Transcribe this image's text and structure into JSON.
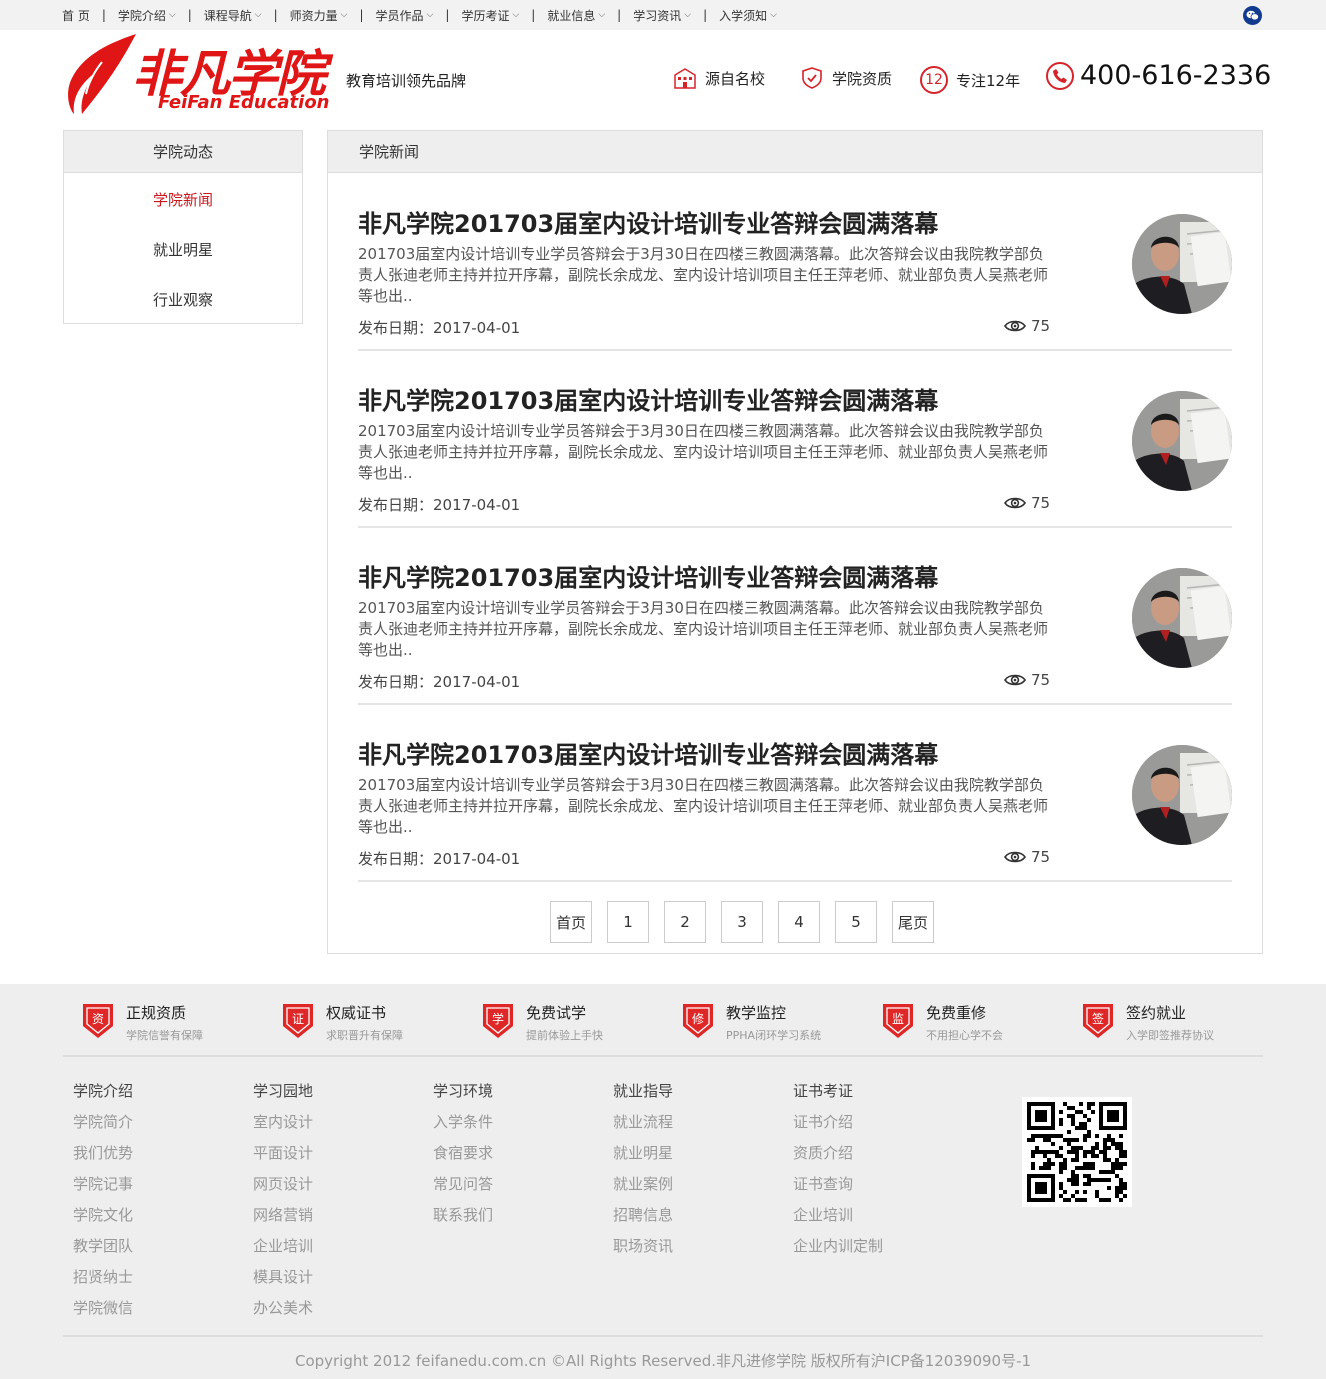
{
  "topnav": {
    "items": [
      {
        "label": "首 页",
        "dropdown": false
      },
      {
        "label": "学院介绍",
        "dropdown": true
      },
      {
        "label": "课程导航",
        "dropdown": true
      },
      {
        "label": "师资力量",
        "dropdown": true
      },
      {
        "label": "学员作品",
        "dropdown": true
      },
      {
        "label": "学历考证",
        "dropdown": true
      },
      {
        "label": "就业信息",
        "dropdown": true
      },
      {
        "label": "学习资讯",
        "dropdown": true
      },
      {
        "label": "入学须知",
        "dropdown": true
      }
    ],
    "separator": "|",
    "wechat_icon": "wechat-icon"
  },
  "header": {
    "logo_cn": "非凡学院",
    "logo_en": "FeiFan Education",
    "slogan": "教育培训领先品牌",
    "features": [
      {
        "label": "源自名校",
        "icon": "school-building-icon"
      },
      {
        "label": "学院资质",
        "icon": "shield-check-icon"
      },
      {
        "label": "专注12年",
        "icon": "number-badge-icon",
        "badge": "12"
      }
    ],
    "phone": "400-616-2336",
    "brand_color": "#d6242b"
  },
  "sidebar": {
    "title": "学院动态",
    "items": [
      {
        "label": "学院新闻",
        "active": true
      },
      {
        "label": "就业明星",
        "active": false
      },
      {
        "label": "行业观察",
        "active": false
      }
    ]
  },
  "main": {
    "title": "学院新闻",
    "date_label": "发布日期：",
    "articles": [
      {
        "title": "非凡学院201703届室内设计培训专业答辩会圆满落幕",
        "desc": "201703届室内设计培训专业学员答辩会于3月30日在四楼三教圆满落幕。此次答辩会议由我院教学部负责人张迪老师主持并拉开序幕，副院长余成龙、室内设计培训项目主任王萍老师、就业部负责人吴燕老师等也出..",
        "date": "2017-04-01",
        "views": "75"
      },
      {
        "title": "非凡学院201703届室内设计培训专业答辩会圆满落幕",
        "desc": "201703届室内设计培训专业学员答辩会于3月30日在四楼三教圆满落幕。此次答辩会议由我院教学部负责人张迪老师主持并拉开序幕，副院长余成龙、室内设计培训项目主任王萍老师、就业部负责人吴燕老师等也出..",
        "date": "2017-04-01",
        "views": "75"
      },
      {
        "title": "非凡学院201703届室内设计培训专业答辩会圆满落幕",
        "desc": "201703届室内设计培训专业学员答辩会于3月30日在四楼三教圆满落幕。此次答辩会议由我院教学部负责人张迪老师主持并拉开序幕，副院长余成龙、室内设计培训项目主任王萍老师、就业部负责人吴燕老师等也出..",
        "date": "2017-04-01",
        "views": "75"
      },
      {
        "title": "非凡学院201703届室内设计培训专业答辩会圆满落幕",
        "desc": "201703届室内设计培训专业学员答辩会于3月30日在四楼三教圆满落幕。此次答辩会议由我院教学部负责人张迪老师主持并拉开序幕，副院长余成龙、室内设计培训项目主任王萍老师、就业部负责人吴燕老师等也出..",
        "date": "2017-04-01",
        "views": "75"
      }
    ],
    "pagination": [
      "首页",
      "1",
      "2",
      "3",
      "4",
      "5",
      "尾页"
    ]
  },
  "footer": {
    "guarantees": [
      {
        "badge": "资",
        "title": "正规资质",
        "sub": "学院信誉有保障"
      },
      {
        "badge": "证",
        "title": "权威证书",
        "sub": "求职晋升有保障"
      },
      {
        "badge": "学",
        "title": "免费试学",
        "sub": "提前体验上手快"
      },
      {
        "badge": "修",
        "title": "教学监控",
        "sub": "PPHA闭环学习系统"
      },
      {
        "badge": "监",
        "title": "免费重修",
        "sub": "不用担心学不会"
      },
      {
        "badge": "签",
        "title": "签约就业",
        "sub": "入学即签推荐协议"
      }
    ],
    "columns": [
      {
        "title": "学院介绍",
        "items": [
          "学院简介",
          "我们优势",
          "学院记事",
          "学院文化",
          "教学团队",
          "招贤纳士",
          "学院微信"
        ]
      },
      {
        "title": "学习园地",
        "items": [
          "室内设计",
          "平面设计",
          "网页设计",
          "网络营销",
          "企业培训",
          "模具设计",
          "办公美术"
        ]
      },
      {
        "title": "学习环境",
        "items": [
          "入学条件",
          "食宿要求",
          "常见问答",
          "联系我们"
        ]
      },
      {
        "title": "就业指导",
        "items": [
          "就业流程",
          "就业明星",
          "就业案例",
          "招聘信息",
          "职场资讯"
        ]
      },
      {
        "title": "证书考证",
        "items": [
          "证书介绍",
          "资质介绍",
          "证书查询",
          "企业培训",
          "企业内训定制"
        ]
      }
    ],
    "copyright": "Copyright 2012 feifanedu.com.cn ©All Rights Reserved.非凡进修学院 版权所有沪ICP备12039090号-1"
  }
}
